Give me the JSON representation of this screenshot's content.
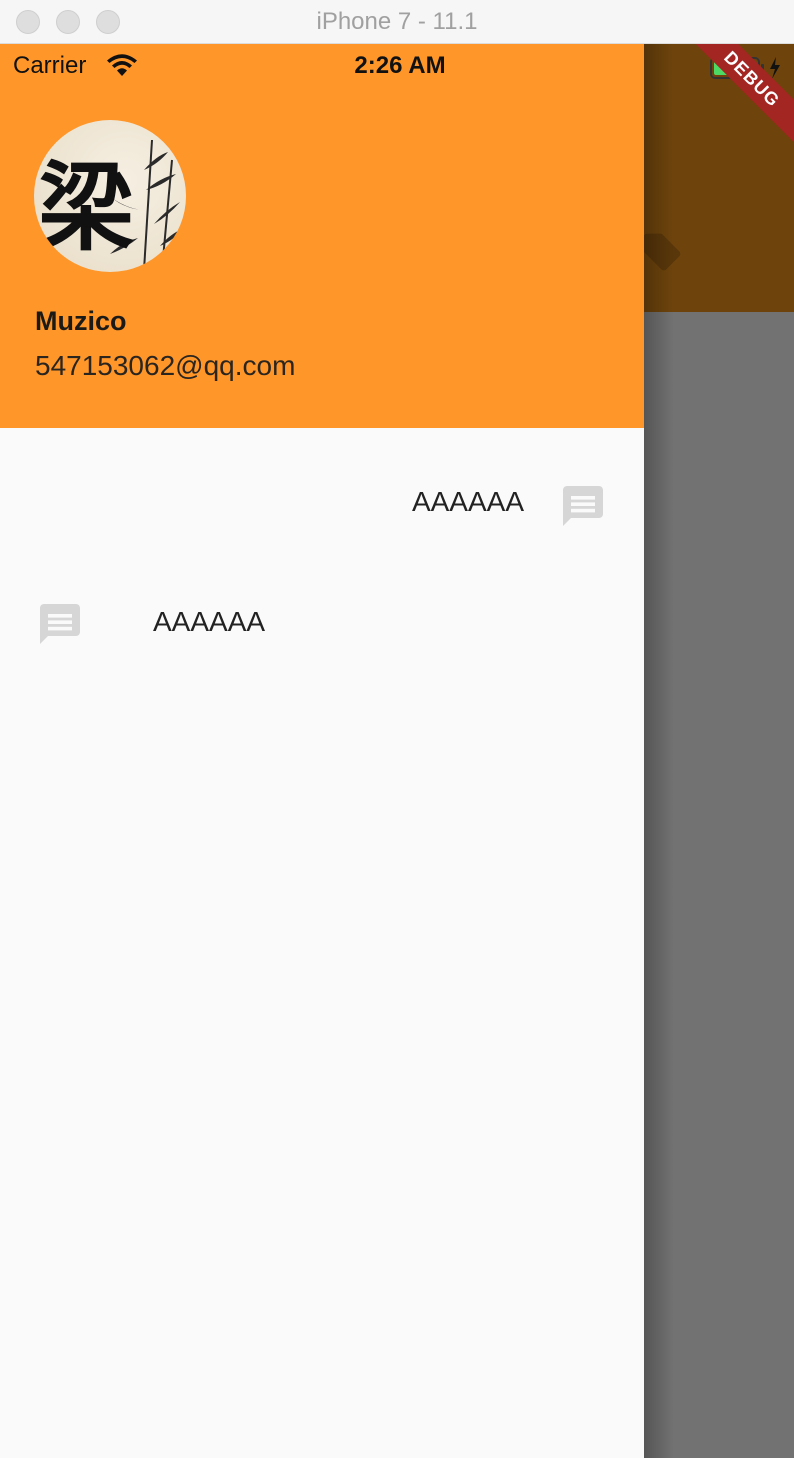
{
  "window": {
    "title": "iPhone 7 - 11.1"
  },
  "statusbar": {
    "carrier": "Carrier",
    "time": "2:26 AM"
  },
  "debug_banner": {
    "label": "DEBUG"
  },
  "drawer": {
    "account": {
      "name": "Muzico",
      "email": "547153062@qq.com",
      "avatar_glyph": "梁"
    },
    "items": [
      {
        "label": "AAAAAA",
        "icon": "chat-icon"
      },
      {
        "label": "AAAAAA",
        "icon": "chat-icon"
      }
    ]
  },
  "colors": {
    "header": "#fe9629",
    "drawer_bg": "#fafafa",
    "scrim": "#727272",
    "appbar_behind": "#6f440c",
    "debug": "#a32622",
    "icon_gray": "#d6d6d6"
  }
}
